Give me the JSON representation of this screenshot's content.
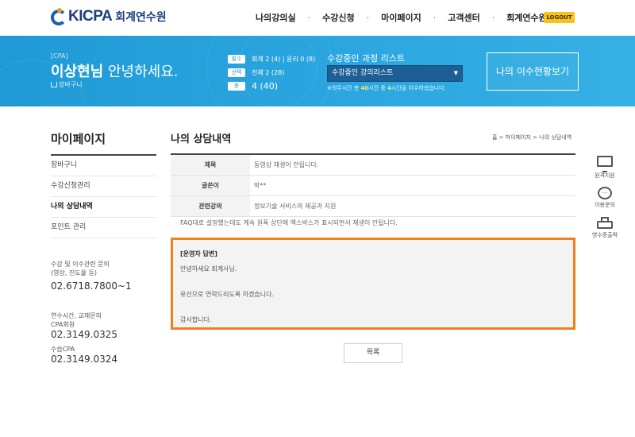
{
  "header": {
    "logo_text": "KICPA",
    "logo_kor": "회계연수원",
    "nav": [
      "나의강의실",
      "수강신청",
      "마이페이지",
      "고객센터",
      "회계연수원"
    ],
    "logout_label": "LOGOUT"
  },
  "banner": {
    "cpa_tag": "[CPA]",
    "user_name": "이상현님",
    "greeting": "안녕하세요.",
    "cart_label": "장바구니",
    "stats": [
      {
        "pill": "필수",
        "text": "회계 2 (4) | 윤리 0 (8)"
      },
      {
        "pill": "선택",
        "text": "전체 2 (28)"
      },
      {
        "pill": "총",
        "text": "4 (40)"
      }
    ],
    "course_list_title": "수강중인 과정 리스트",
    "course_select_value": "수강중인 강의리스트",
    "note_prefix": "※의무시간 총 ",
    "note_total": "40",
    "note_middle": "시간 중 ",
    "note_done": "4",
    "note_suffix": "시간을 이수하셨습니다.",
    "status_button": "나의 이수현황보기"
  },
  "sidebar": {
    "title": "마이페이지",
    "items": [
      {
        "label": "장바구니",
        "active": false
      },
      {
        "label": "수강신청관리",
        "active": false
      },
      {
        "label": "나의 상담내역",
        "active": true
      },
      {
        "label": "포인트 관리",
        "active": false
      }
    ],
    "contact1_label": "수강 및 이수관련 문의",
    "contact1_sub": "(영상, 진도율 등)",
    "contact1_number": "02.6718.7800~1",
    "contact2_label": "연수시간, 교재문의",
    "contact2_sub": "CPA회원",
    "contact2_number": "02.3149.0325",
    "contact3_sub": "수습CPA",
    "contact3_number": "02.3149.0324"
  },
  "main": {
    "title": "나의 상담내역",
    "breadcrumb": "홈 > 마이페이지 > 나의 상담내역",
    "rows": [
      {
        "label": "제목",
        "value": "동영상 재생이 안됩니다."
      },
      {
        "label": "글쓴이",
        "value": "박**"
      },
      {
        "label": "관련강의",
        "value": "정보기술 서비스의 제공과 지원"
      }
    ],
    "question": "FAQ대로 설정했는데도 계속 원폭 상단에 엑스박스가 표시되면서 재생이 안됩니다.",
    "answer": {
      "label": "[운영자 답변]",
      "lines": [
        "안녕하세요 회계사님.",
        "",
        "유선으로 연락드리도록 하겠습니다.",
        "",
        "감사합니다."
      ]
    },
    "list_button": "목록"
  },
  "quick_menu": [
    {
      "icon": "monitor-icon",
      "label": "원격지원"
    },
    {
      "icon": "chat-icon",
      "label": "이용문의"
    },
    {
      "icon": "printer-icon",
      "label": "영수증출력"
    }
  ],
  "colors": {
    "banner": "#2aa5df",
    "logout": "#f7c315",
    "answer_border": "#f0801a",
    "select_bg": "#1b5f95"
  }
}
